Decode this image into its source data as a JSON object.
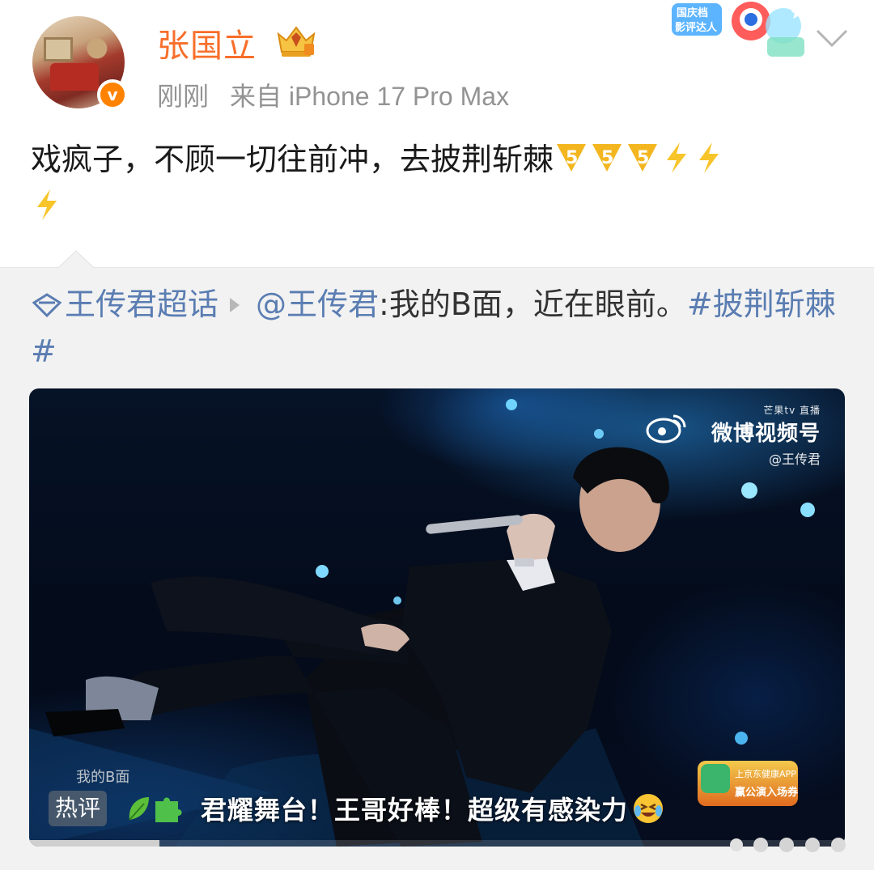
{
  "post": {
    "username": "张国立",
    "time": "刚刚",
    "source": "来自 iPhone 17 Pro Max",
    "verified_mark": "v",
    "text": "戏疯子，不顾一切往前冲，去披荆斩棘",
    "badge_text_1": "国庆档",
    "badge_text_2": "影评达人"
  },
  "retweet": {
    "super_topic": "王传君超话",
    "mention": "@王传君",
    "text": ":我的B面，近在眼前。",
    "hashtag": "#披荆斩棘#"
  },
  "video": {
    "watermark_brand": "芒果tv 直播",
    "watermark_main": "微博视频号",
    "watermark_handle": "@王传君",
    "song_title": "我的B面",
    "ad_line1": "上京东健康APP",
    "ad_line2": "赢公演入场券",
    "hot_label": "热评",
    "hot_comment": "君耀舞台！王哥好棒！超级有感染力",
    "progress": 0.16
  },
  "colors": {
    "username": "#f86e2a",
    "link": "#5a7db2",
    "meta": "#939393"
  }
}
